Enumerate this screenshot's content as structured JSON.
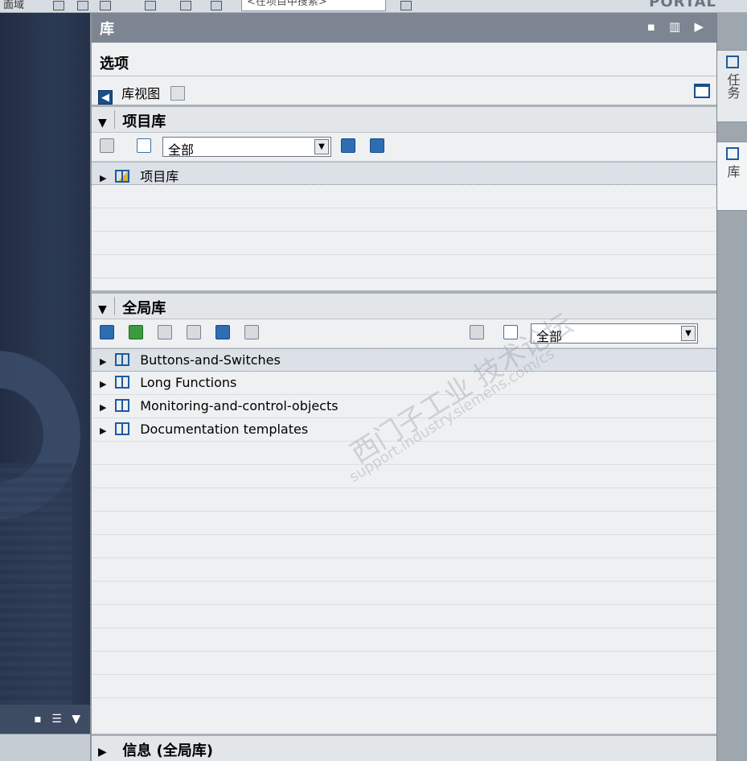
{
  "topbar": {
    "left_text": "面域",
    "search_placeholder": "<在项目中搜索>",
    "portal_text": "PORTAL"
  },
  "library_panel": {
    "title": "库",
    "options_title": "选项",
    "library_view_label": "库视图",
    "project_library": {
      "title": "项目库",
      "filter_value": "全部",
      "items": [
        {
          "label": "项目库",
          "selected": true
        }
      ]
    },
    "global_library": {
      "title": "全局库",
      "filter_value": "全部",
      "items": [
        {
          "label": "Buttons-and-Switches",
          "selected": true
        },
        {
          "label": "Long Functions",
          "selected": false
        },
        {
          "label": "Monitoring-and-control-objects",
          "selected": false
        },
        {
          "label": "Documentation templates",
          "selected": false
        }
      ]
    },
    "info_section_title": "信息 (全局库)"
  },
  "right_tabs": [
    {
      "label": "任务",
      "icon": "tasks-icon"
    },
    {
      "label": "库",
      "icon": "library-icon"
    }
  ],
  "watermark": {
    "line1": "西门子工业 技术论坛",
    "line2": "support.industry.siemens.com/cs"
  }
}
